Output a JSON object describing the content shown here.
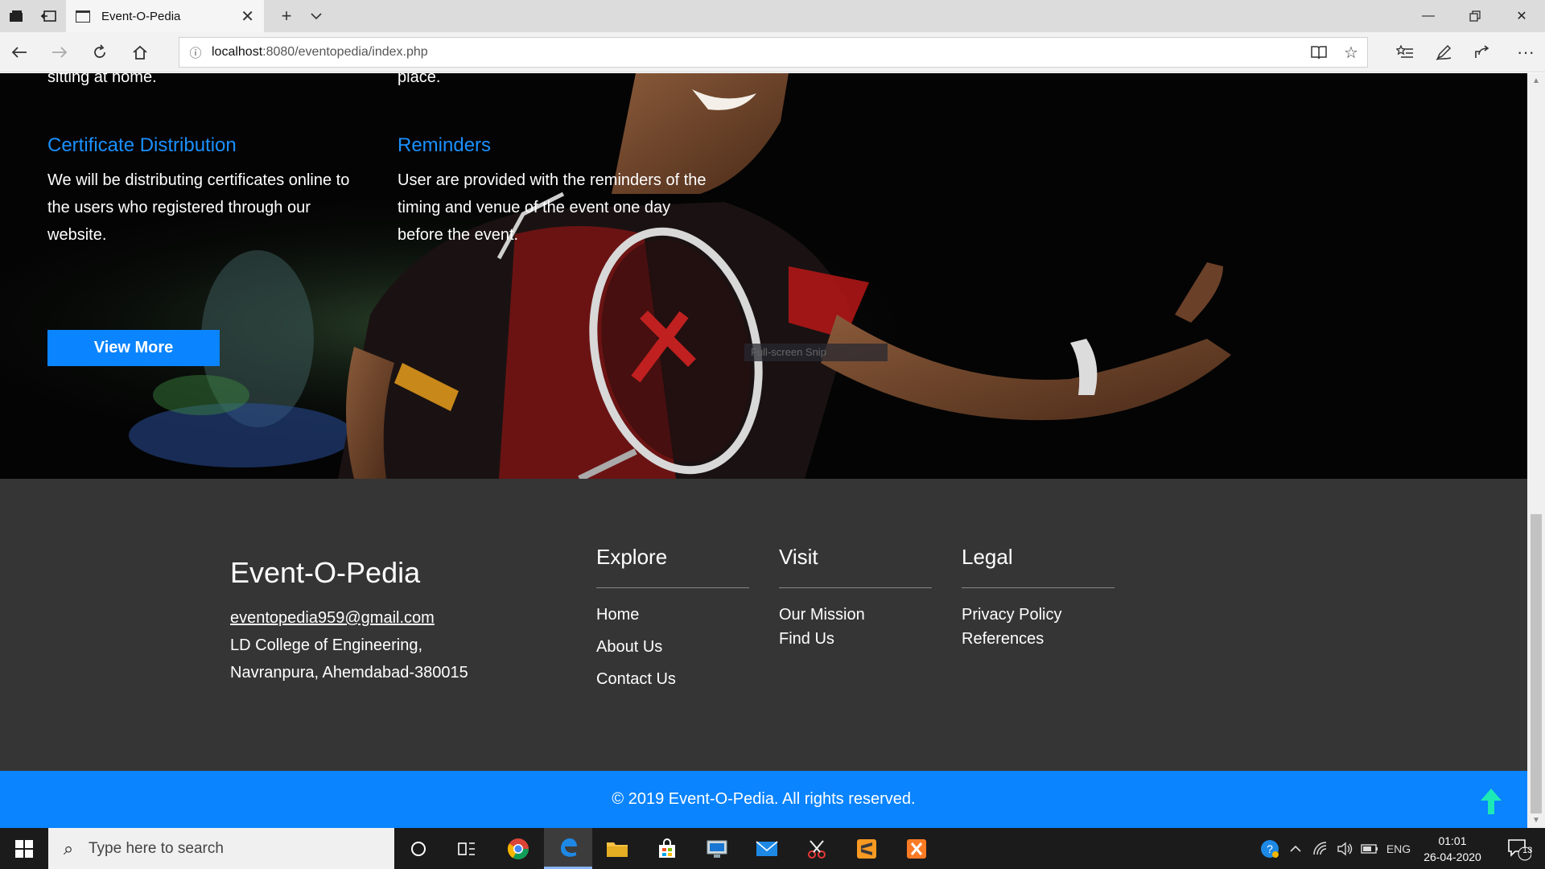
{
  "browser": {
    "tab_title": "Event-O-Pedia",
    "url_host": "localhost",
    "url_rest": ":8080/eventopedia/index.php"
  },
  "hero": {
    "cut_text_left": "sitting at home.",
    "cut_text_right": "place.",
    "features": [
      {
        "title": "Certificate Distribution",
        "description": "We will be distributing certificates online to the users who registered through our website."
      },
      {
        "title": "Reminders",
        "description": "User are provided with the reminders of the timing and venue of the event one day before the event."
      }
    ],
    "view_more_label": "View More",
    "snip_tooltip": "Full-screen Snip"
  },
  "footer": {
    "brand": "Event-O-Pedia",
    "email": "eventopedia959@gmail.com",
    "address_line1": "LD College of Engineering,",
    "address_line2": "Navranpura, Ahemdabad-380015",
    "columns": [
      {
        "heading": "Explore",
        "links": [
          "Home",
          "About Us",
          "Contact Us"
        ]
      },
      {
        "heading": "Visit",
        "links": [
          "Our Mission",
          "Find Us"
        ]
      },
      {
        "heading": "Legal",
        "links": [
          "Privacy Policy",
          "References"
        ]
      }
    ],
    "copyright": "© 2019 Event-O-Pedia. All rights reserved."
  },
  "taskbar": {
    "search_placeholder": "Type here to search",
    "language": "ENG",
    "time": "01:01",
    "date": "26-04-2020",
    "notification_count": "13"
  },
  "colors": {
    "accent_blue": "#0a84ff",
    "feature_title_blue": "#1a90ff",
    "footer_bg": "#353535",
    "back_to_top": "#1de9b6"
  }
}
